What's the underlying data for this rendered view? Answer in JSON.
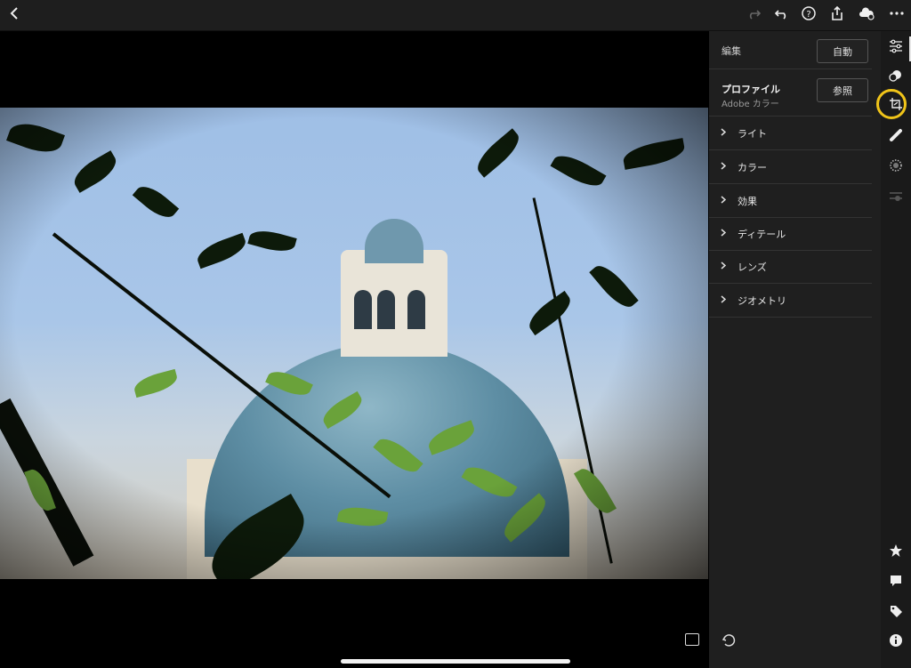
{
  "topbar": {
    "back_icon": "chevron-left-icon",
    "redo_icon": "redo-icon",
    "undo_icon": "undo-icon",
    "help_icon": "help-icon",
    "share_icon": "share-icon",
    "cloud_icon": "cloud-sync-icon",
    "more_icon": "more-icon"
  },
  "panel": {
    "edit_label": "編集",
    "auto_button": "自動",
    "profile_title": "プロファイル",
    "profile_value": "Adobe カラー",
    "browse_button": "参照",
    "sections": [
      {
        "label": "ライト"
      },
      {
        "label": "カラー"
      },
      {
        "label": "効果"
      },
      {
        "label": "ディテール"
      },
      {
        "label": "レンズ"
      },
      {
        "label": "ジオメトリ"
      }
    ]
  },
  "rail": {
    "tools": [
      "edit-sliders-icon",
      "heal-icon",
      "crop-icon",
      "brush-icon",
      "selective-icon",
      "presets-icon"
    ],
    "bottom": [
      "star-icon",
      "comment-icon",
      "tag-icon",
      "info-icon"
    ],
    "highlight_color": "#f0c419"
  },
  "colors": {
    "background": "#000000",
    "panel": "#1f1f1f",
    "accent": "#f0c419"
  }
}
